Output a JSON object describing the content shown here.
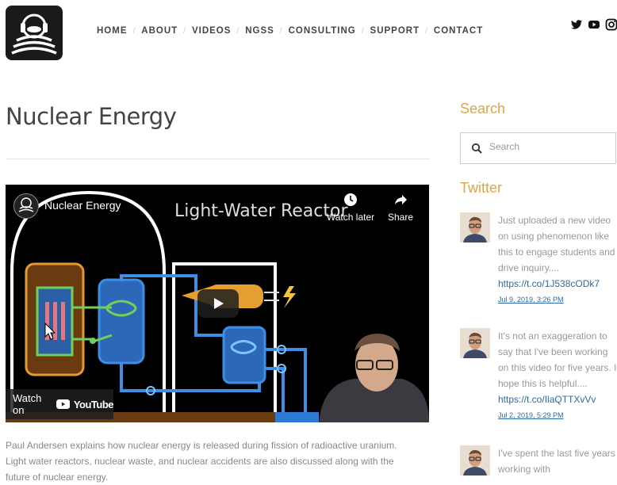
{
  "nav": {
    "items": [
      {
        "label": "HOME"
      },
      {
        "label": "ABOUT"
      },
      {
        "label": "VIDEOS"
      },
      {
        "label": "NGSS"
      },
      {
        "label": "CONSULTING"
      },
      {
        "label": "SUPPORT"
      },
      {
        "label": "CONTACT"
      }
    ]
  },
  "social": [
    "twitter-icon",
    "youtube-icon",
    "instagram-icon"
  ],
  "main": {
    "title": "Nuclear Energy",
    "video": {
      "title": "Nuclear Energy",
      "heading": "Light-Water Reactor",
      "watch_later": "Watch later",
      "share": "Share",
      "watch_on": "Watch on",
      "youtube": "YouTube"
    },
    "description": "Paul Andersen explains how nuclear energy is released during fission of radioactive uranium. Light water reactors, nuclear waste, and nuclear accidents are also discussed along with the future of nuclear energy."
  },
  "sidebar": {
    "search_heading": "Search",
    "search_placeholder": "Search",
    "twitter_heading": "Twitter",
    "tweets": [
      {
        "text": "Just uploaded a new video on using phenomenon like this to engage students and drive inquiry....",
        "link": "https://t.co/1J538cODk7",
        "date": "Jul 9, 2019, 3:26 PM"
      },
      {
        "text": "It's not an exaggeration to say that I've been working on this video for five years. I hope this is helpful....",
        "link": "https://t.co/IlaQTTXvVv",
        "date": "Jul 2, 2019, 5:29 PM"
      },
      {
        "text": "I've spent the last five years working with",
        "link": "",
        "date": ""
      }
    ]
  },
  "colors": {
    "accent": "#e2a448",
    "link": "#2d6aa6"
  }
}
